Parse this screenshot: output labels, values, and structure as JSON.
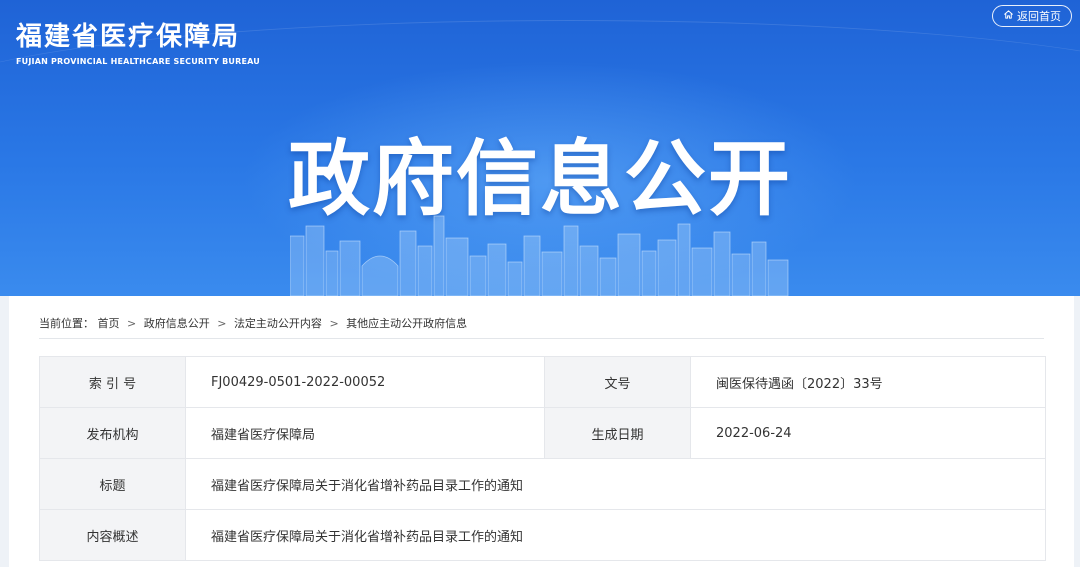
{
  "header": {
    "org_name_cn": "福建省医疗保障局",
    "org_name_en": "FUJIAN PROVINCIAL HEALTHCARE SECURITY BUREAU",
    "home_button_label": "返回首页",
    "home_icon": "home-icon",
    "hero_title": "政府信息公开"
  },
  "breadcrumb": {
    "prefix": "当前位置：",
    "items": [
      "首页",
      "政府信息公开",
      "法定主动公开内容",
      "其他应主动公开政府信息"
    ],
    "separator": ">"
  },
  "meta_table": {
    "index_label": "索 引 号",
    "index_value": "FJ00429-0501-2022-00052",
    "doc_no_label": "文号",
    "doc_no_value": "闽医保待遇函〔2022〕33号",
    "publisher_label": "发布机构",
    "publisher_value": "福建省医疗保障局",
    "date_label": "生成日期",
    "date_value": "2022-06-24",
    "title_label": "标题",
    "title_value": "福建省医疗保障局关于消化省增补药品目录工作的通知",
    "summary_label": "内容概述",
    "summary_value": "福建省医疗保障局关于消化省增补药品目录工作的通知"
  },
  "colors": {
    "banner_blue": "#2a78e6",
    "label_bg": "#f3f4f6",
    "border": "#e5e7eb"
  }
}
